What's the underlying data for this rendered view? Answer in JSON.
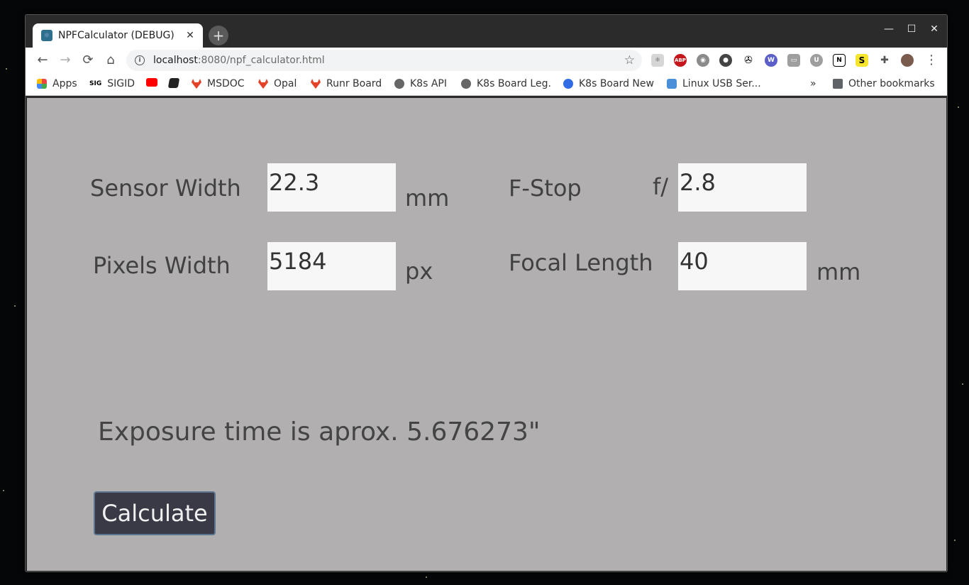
{
  "tab": {
    "title": "NPFCalculator (DEBUG)",
    "close": "✕",
    "new_tab": "+"
  },
  "window_controls": {
    "minimize": "—",
    "maximize": "☐",
    "close": "✕"
  },
  "toolbar": {
    "back": "←",
    "forward": "→",
    "reload": "⟳",
    "home": "⌂",
    "url_host": "localhost",
    "url_rest": ":8080/npf_calculator.html",
    "bookmark_star": "☆",
    "menu": "⋮"
  },
  "extensions": [
    "react-icon",
    "adblock-icon",
    "discord-icon",
    "circle-icon",
    "gimp-icon",
    "wappalyzer-icon",
    "tab-icon",
    "ublock-icon",
    "notion-icon",
    "s-icon",
    "puzzle-icon",
    "profile-avatar"
  ],
  "extension_labels": {
    "adblock": "ABP",
    "notion": "N",
    "s": "S",
    "wappalyzer": "W",
    "ublock": "U"
  },
  "bookmarks": {
    "apps": "Apps",
    "sigid": "SIGID",
    "sigid_icon_text": "SIG",
    "msdoc": "MSDOC",
    "opal": "Opal",
    "runr": "Runr Board",
    "k8s_api": "K8s API",
    "k8s_leg": "K8s Board Leg.",
    "k8s_new": "K8s Board New",
    "linux_usb": "Linux USB Ser...",
    "overflow": "»",
    "other": "Other bookmarks"
  },
  "form": {
    "sensor_width_label": "Sensor Width",
    "sensor_width_value": "22.3",
    "sensor_width_unit": "mm",
    "pixels_width_label": "Pixels Width",
    "pixels_width_value": "5184",
    "pixels_width_unit": "px",
    "fstop_label": "F-Stop",
    "fstop_prefix": "f/",
    "fstop_value": "2.8",
    "focal_length_label": "Focal Length",
    "focal_length_value": "40",
    "focal_length_unit": "mm"
  },
  "result_text": "Exposure time is aprox. 5.676273\"",
  "calculate_label": "Calculate"
}
